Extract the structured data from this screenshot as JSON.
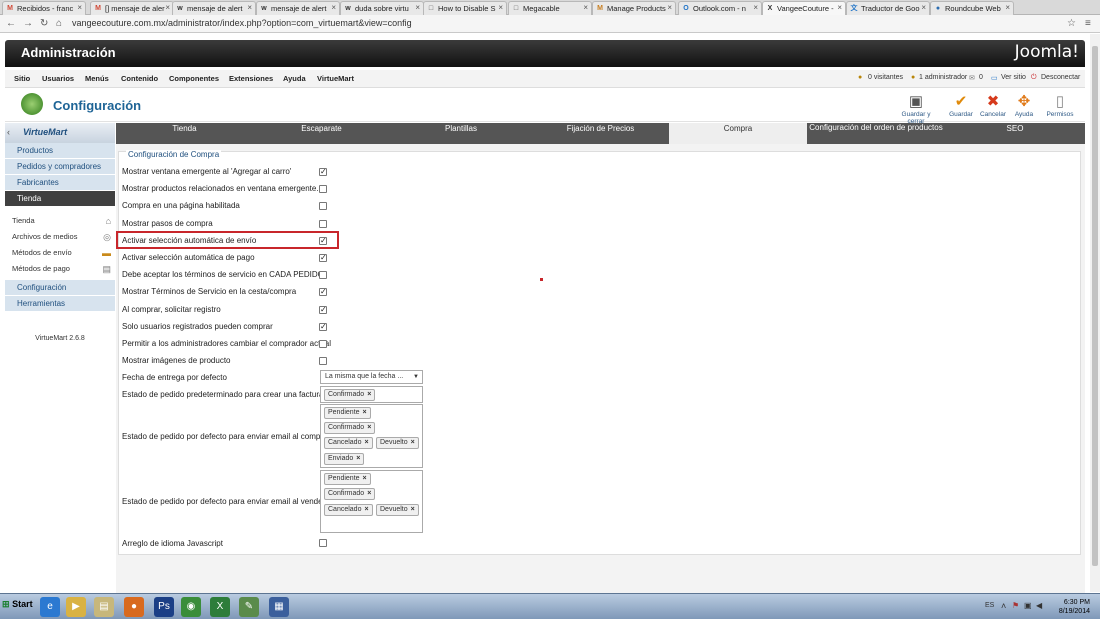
{
  "browser": {
    "tabs": [
      {
        "label": "Recibidos - franc",
        "fav": "M",
        "color": "#d14836"
      },
      {
        "label": "[] mensaje de aler",
        "fav": "M",
        "color": "#d14836"
      },
      {
        "label": "mensaje de alert",
        "fav": "w",
        "color": "#333"
      },
      {
        "label": "mensaje de alert",
        "fav": "w",
        "color": "#333"
      },
      {
        "label": "duda sobre virtu",
        "fav": "w",
        "color": "#333"
      },
      {
        "label": "How to Disable S",
        "fav": "□",
        "color": "#555"
      },
      {
        "label": "Megacable",
        "fav": "□",
        "color": "#555"
      },
      {
        "label": "Manage Products",
        "fav": "M",
        "color": "#c77d1f"
      },
      {
        "label": "Outlook.com - n",
        "fav": "O",
        "color": "#1f73c7"
      },
      {
        "label": "VangeeCouture -",
        "fav": "X",
        "color": "#333"
      },
      {
        "label": "Traductor de Goo",
        "fav": "文",
        "color": "#1f73c7"
      },
      {
        "label": "Roundcube Web",
        "fav": "●",
        "color": "#2b6cb0"
      }
    ],
    "url": "vangeecouture.com.mx/administrator/index.php?option=com_virtuemart&view=config"
  },
  "header": {
    "title": "Administración",
    "logo": "Joomla!"
  },
  "menu": {
    "items": [
      "Sitio",
      "Usuarios",
      "Menús",
      "Contenido",
      "Componentes",
      "Extensiones",
      "Ayuda",
      "VirtueMart"
    ],
    "status": [
      "0 visitantes",
      "1 administrador",
      "0",
      "Ver sitio",
      "Desconectar"
    ]
  },
  "toolbar": {
    "page_title": "Configuración",
    "buttons": [
      "Guardar y cerrar",
      "Guardar",
      "Cancelar",
      "Ayuda",
      "Permisos"
    ],
    "icon_colors": [
      "#555555",
      "#e08a0a",
      "#d63a1c",
      "#e07a1a",
      "#888888"
    ]
  },
  "sidebar": {
    "logo": "VirtueMart",
    "groups": [
      "Productos",
      "Pedidos y compradores",
      "Fabricantes",
      "Tienda"
    ],
    "sub_items": [
      "Tienda",
      "Archivos de medios",
      "Métodos de envío",
      "Métodos de pago"
    ],
    "bottom_groups": [
      "Configuración",
      "Herramientas"
    ],
    "version": "VirtueMart 2.6.8"
  },
  "tabs": [
    "Tienda",
    "Escaparate",
    "Plantillas",
    "Fijación de Precios",
    "Compra",
    "Configuración del orden de productos",
    "SEO"
  ],
  "section": {
    "legend": "Configuración de Compra",
    "options": [
      {
        "label": "Mostrar ventana emergente al 'Agregar al carro'",
        "checked": true
      },
      {
        "label": "Mostrar productos relacionados en ventana emergente.",
        "checked": false
      },
      {
        "label": "Compra en una página habilitada",
        "checked": false
      },
      {
        "label": "Mostrar pasos de compra",
        "checked": false
      },
      {
        "label": "Activar selección automática de envío",
        "checked": true
      },
      {
        "label": "Activar selección automática de pago",
        "checked": true
      },
      {
        "label": "Debe aceptar los términos de servicio en CADA PEDIDO",
        "checked": false
      },
      {
        "label": "Mostrar Términos de Servicio en la cesta/compra",
        "checked": true
      },
      {
        "label": "Al comprar, solicitar registro",
        "checked": true
      },
      {
        "label": "Solo usuarios registrados pueden comprar",
        "checked": true
      },
      {
        "label": "Permitir a los administradores cambiar el comprador actual",
        "checked": false
      },
      {
        "label": "Mostrar imágenes de producto",
        "checked": false
      }
    ],
    "delivery_label": "Fecha de entrega por defecto",
    "delivery_value": "La misma que la fecha ...",
    "invoice_label": "Estado de pedido predeterminado para crear una factura",
    "invoice_tags": [
      "Confirmado"
    ],
    "email_buyer_label": "Estado de pedido por defecto para enviar email al comprador",
    "email_buyer_tags": [
      "Pendiente",
      "Confirmado",
      "Cancelado",
      "Devuelto",
      "Enviado"
    ],
    "email_vendor_label": "Estado de pedido por defecto para enviar email al vendedor",
    "email_vendor_tags": [
      "Pendiente",
      "Confirmado",
      "Cancelado",
      "Devuelto"
    ],
    "js_label": "Arreglo de idioma Javascript",
    "js_checked": false
  },
  "taskbar": {
    "start": "Start",
    "lang": "ES",
    "time": "6:30 PM",
    "date": "8/19/2014"
  }
}
